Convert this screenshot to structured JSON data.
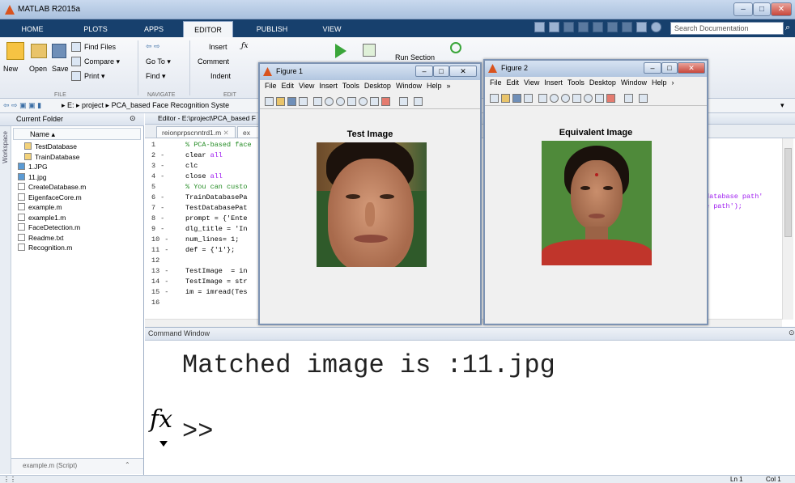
{
  "app": {
    "title": "MATLAB R2015a",
    "window_controls": [
      "–",
      "□",
      "✕"
    ]
  },
  "toolstrip": {
    "tabs": [
      "HOME",
      "PLOTS",
      "APPS",
      "EDITOR",
      "PUBLISH",
      "VIEW"
    ],
    "active_tab": "EDITOR",
    "search_placeholder": "Search Documentation"
  },
  "ribbon": {
    "file": {
      "new": "New",
      "open": "Open",
      "save": "Save",
      "find_files": "Find Files",
      "compare": "Compare ▾",
      "print": "Print ▾",
      "label": "FILE"
    },
    "navigate": {
      "go_to": "Go To ▾",
      "find": "Find ▾",
      "label": "NAVIGATE"
    },
    "edit": {
      "insert": "Insert",
      "comment": "Comment",
      "indent": "Indent",
      "label": "EDIT"
    },
    "run": {
      "run_section": "Run Section"
    }
  },
  "address": {
    "path": "▸ E: ▸ project ▸ PCA_based Face Recognition Syste"
  },
  "current_folder": {
    "title": "Current Folder",
    "name_header": "Name ▴",
    "workspace_label": "Workspace",
    "items": [
      {
        "label": "TestDatabase",
        "kind": "folder"
      },
      {
        "label": "TrainDatabase",
        "kind": "folder"
      },
      {
        "label": "1.JPG",
        "kind": "image"
      },
      {
        "label": "11.jpg",
        "kind": "image"
      },
      {
        "label": "CreateDatabase.m",
        "kind": "mfile"
      },
      {
        "label": "EigenfaceCore.m",
        "kind": "mfile"
      },
      {
        "label": "example.m",
        "kind": "mfile"
      },
      {
        "label": "example1.m",
        "kind": "mfile"
      },
      {
        "label": "FaceDetection.m",
        "kind": "mfile"
      },
      {
        "label": "Readme.txt",
        "kind": "text"
      },
      {
        "label": "Recognition.m",
        "kind": "mfile"
      }
    ],
    "footer": "example.m (Script)"
  },
  "editor": {
    "title": "Editor - E:\\project\\PCA_based F",
    "tabs": [
      "reionprpscnntrd1.m",
      "ex"
    ],
    "lines": [
      {
        "n": "1",
        "dash": "",
        "code": "% PCA-based face",
        "cls": "cm"
      },
      {
        "n": "2",
        "dash": "-",
        "code": "clear all",
        "cls": "kw2"
      },
      {
        "n": "3",
        "dash": "-",
        "code": "clc",
        "cls": ""
      },
      {
        "n": "4",
        "dash": "-",
        "code": "close all",
        "cls": "kw2"
      },
      {
        "n": "5",
        "dash": "",
        "code": "% You can custo",
        "cls": "cm"
      },
      {
        "n": "6",
        "dash": "-",
        "code": "TrainDatabasePa",
        "cls": ""
      },
      {
        "n": "7",
        "dash": "-",
        "code": "TestDatabasePat",
        "cls": ""
      },
      {
        "n": "8",
        "dash": "-",
        "code": "prompt = {'Ente",
        "cls": ""
      },
      {
        "n": "9",
        "dash": "-",
        "code": "dlg_title = 'In",
        "cls": ""
      },
      {
        "n": "10",
        "dash": "-",
        "code": "num_lines= 1;",
        "cls": ""
      },
      {
        "n": "11",
        "dash": "-",
        "code": "def = {'1'};",
        "cls": ""
      },
      {
        "n": "12",
        "dash": "",
        "code": "",
        "cls": ""
      },
      {
        "n": "13",
        "dash": "-",
        "code": "TestImage  = in",
        "cls": ""
      },
      {
        "n": "14",
        "dash": "-",
        "code": "TestImage = str",
        "cls": ""
      },
      {
        "n": "15",
        "dash": "-",
        "code": "im = imread(Tes",
        "cls": ""
      },
      {
        "n": "16",
        "dash": "",
        "code": "",
        "cls": ""
      }
    ],
    "right_fragments": [
      "database path'",
      "e path');"
    ]
  },
  "command_window": {
    "title": "Command Window",
    "output": "Matched image is :11.jpg",
    "fx": "fx",
    "prompt": ">>"
  },
  "status": {
    "ln": "Ln  1",
    "col": "Col  1"
  },
  "figure1": {
    "title": "Figure 1",
    "menu": [
      "File",
      "Edit",
      "View",
      "Insert",
      "Tools",
      "Desktop",
      "Window",
      "Help"
    ],
    "image_title": "Test Image"
  },
  "figure2": {
    "title": "Figure 2",
    "menu": [
      "File",
      "Edit",
      "View",
      "Insert",
      "Tools",
      "Desktop",
      "Window",
      "Help"
    ],
    "image_title": "Equivalent Image"
  },
  "colors": {
    "tab_strip": "#17406d",
    "accent_orange": "#d9531e",
    "comment_green": "#228b22",
    "keyword_blue": "#0000ff",
    "string_purple": "#a020f0"
  }
}
